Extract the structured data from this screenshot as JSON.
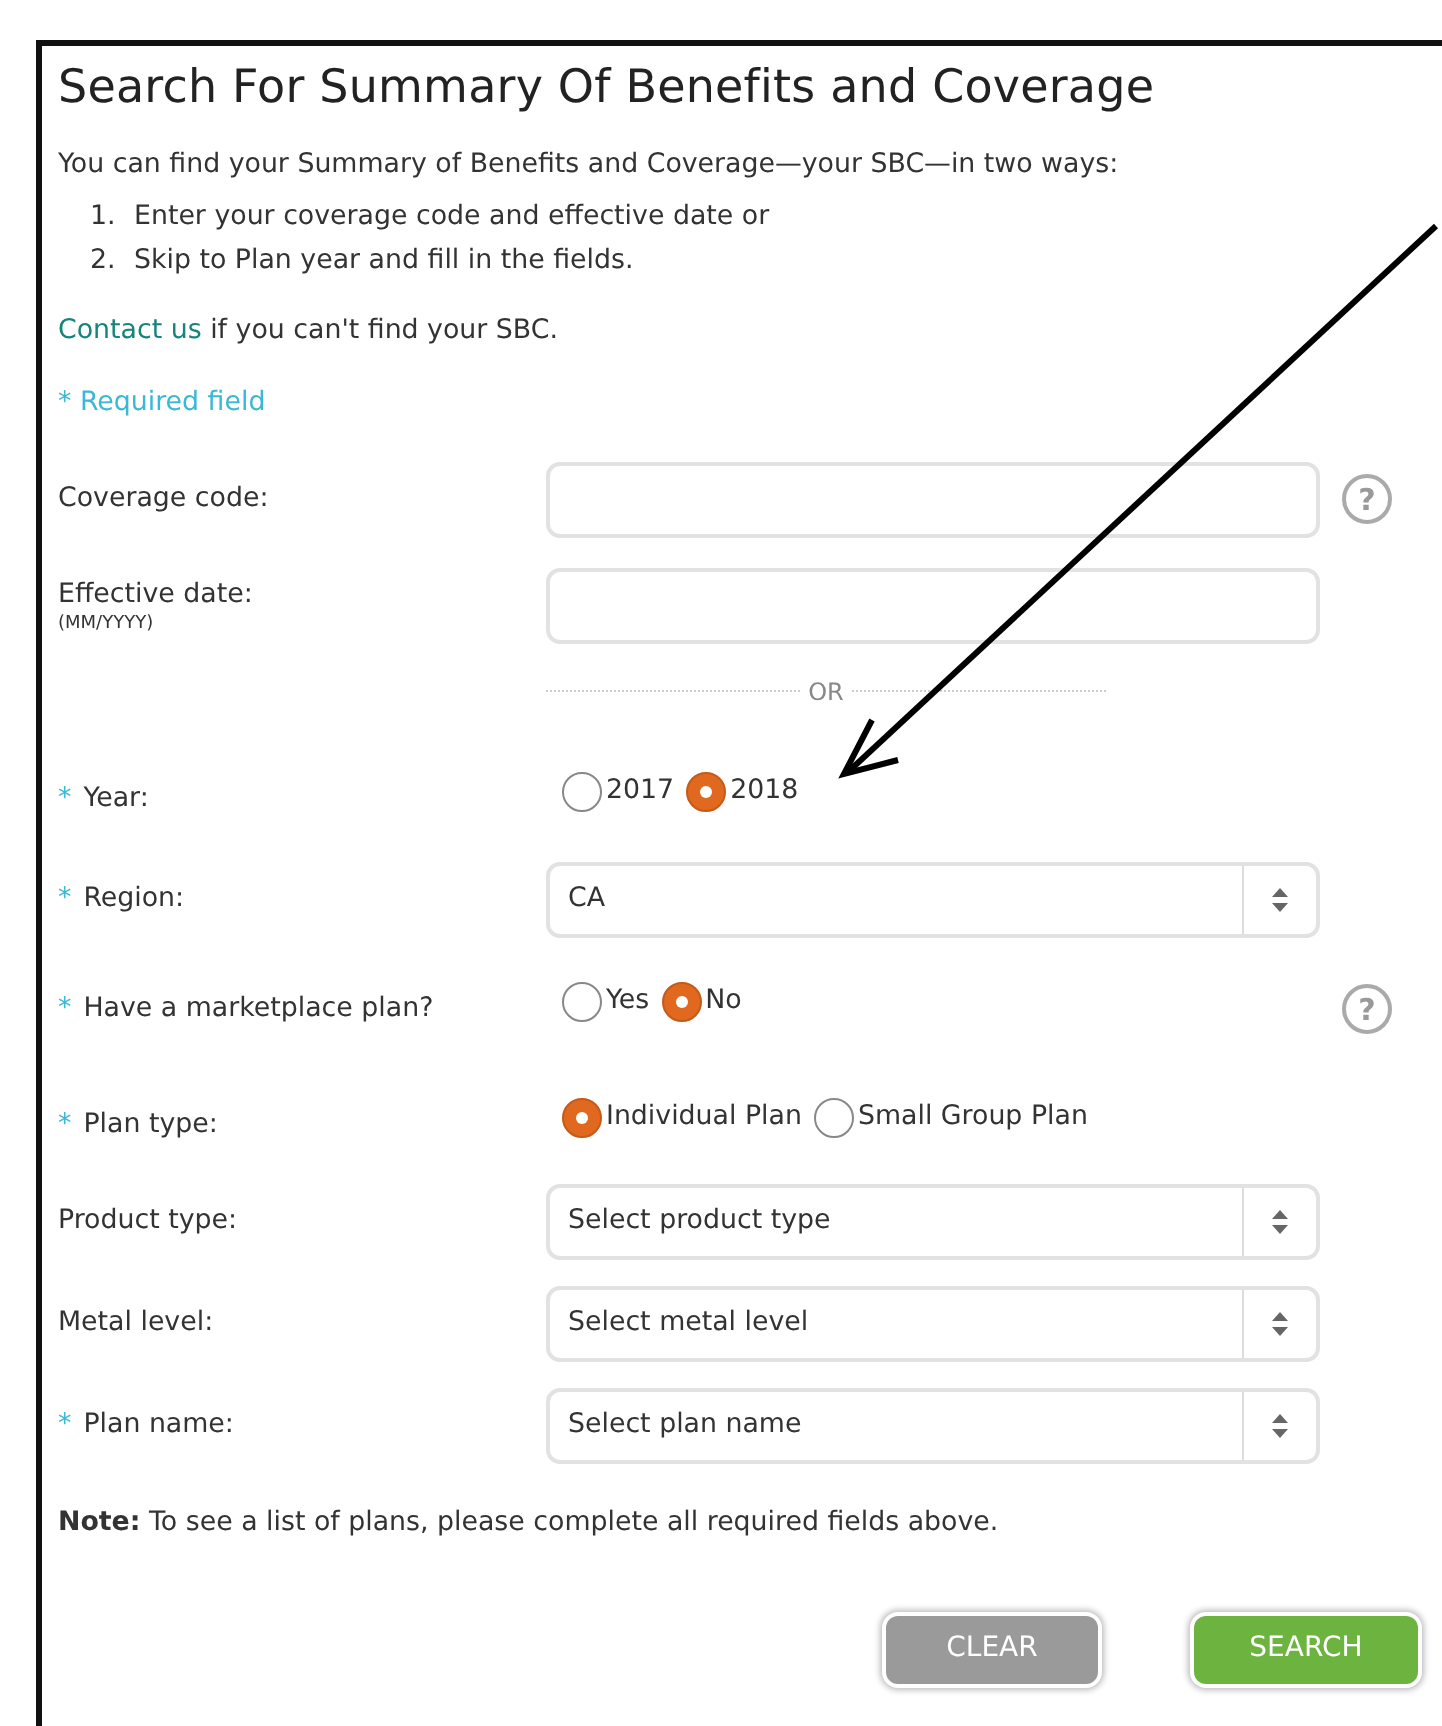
{
  "title": "Search For Summary Of Benefits and Coverage",
  "intro": "You can find your Summary of Benefits and Coverage—your SBC—in two ways:",
  "steps": [
    {
      "marker": "1.",
      "text": "Enter your coverage code and effective date or"
    },
    {
      "marker": "2.",
      "text": "Skip to Plan year and fill in the fields."
    }
  ],
  "contact": {
    "link": "Contact us",
    "text": " if you can't find your SBC."
  },
  "required_note": "* Required field",
  "fields": [
    {
      "kind": "text",
      "label": "Coverage code:",
      "help_icon": "?"
    },
    {
      "kind": "text",
      "label": "Effective date:",
      "sublabel": "(MM/YYYY)"
    },
    {
      "kind": "divider",
      "label": "OR"
    },
    {
      "kind": "radio",
      "asterisk": "*",
      "label": "Year:",
      "options": [
        {
          "label": "2017",
          "selected": false
        },
        {
          "label": "2018",
          "selected": true
        }
      ]
    },
    {
      "kind": "select",
      "asterisk": "*",
      "label": "Region:",
      "value": "CA"
    },
    {
      "kind": "radio",
      "asterisk": "*",
      "label": "Have a marketplace plan?",
      "help_icon": "?",
      "options": [
        {
          "label": "Yes",
          "selected": false
        },
        {
          "label": "No",
          "selected": true
        }
      ]
    },
    {
      "kind": "radio",
      "asterisk": "*",
      "label": "Plan type:",
      "options": [
        {
          "label": "Individual Plan",
          "selected": true
        },
        {
          "label": "Small Group Plan",
          "selected": false
        }
      ]
    },
    {
      "kind": "select",
      "label": "Product type:",
      "value": "Select product type"
    },
    {
      "kind": "select",
      "label": "Metal level:",
      "value": "Select metal level"
    },
    {
      "kind": "select",
      "asterisk": "*",
      "label": "Plan name:",
      "value": "Select plan name"
    }
  ],
  "note": "**Note:** To see a list of plans, please complete all required fields above.",
  "buttons": [
    {
      "label": "CLEAR",
      "kind": "secondary"
    },
    {
      "label": "SEARCH",
      "kind": "primary"
    }
  ]
}
